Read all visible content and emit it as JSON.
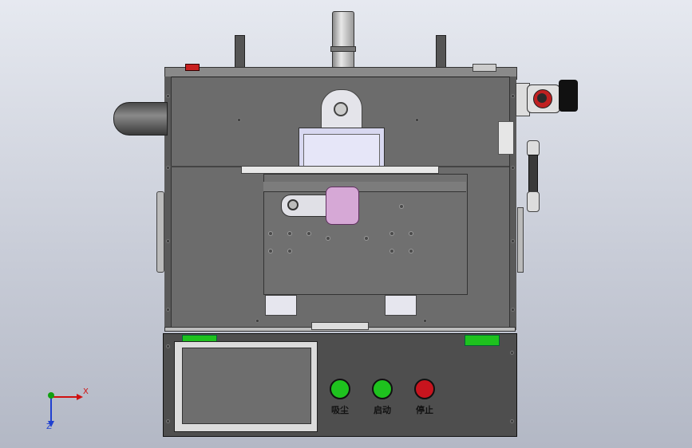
{
  "colors": {
    "background": "#d5d9e2",
    "body_gray": "#6e6e6e",
    "panel_dark": "#4c4c4c",
    "start_green": "#1ec21e",
    "stop_red": "#c8141e",
    "axis_x": "#d01010",
    "axis_y": "#10a010",
    "axis_z": "#2040d0"
  },
  "control_panel": {
    "buttons": [
      {
        "label": "吸尘",
        "color": "green",
        "icon": "dust-suction-button"
      },
      {
        "label": "启动",
        "color": "green",
        "icon": "start-button"
      },
      {
        "label": "停止",
        "color": "red",
        "icon": "stop-button"
      }
    ],
    "screen": "touch-screen"
  },
  "axes": {
    "x_label": "X",
    "z_label": "Z"
  }
}
